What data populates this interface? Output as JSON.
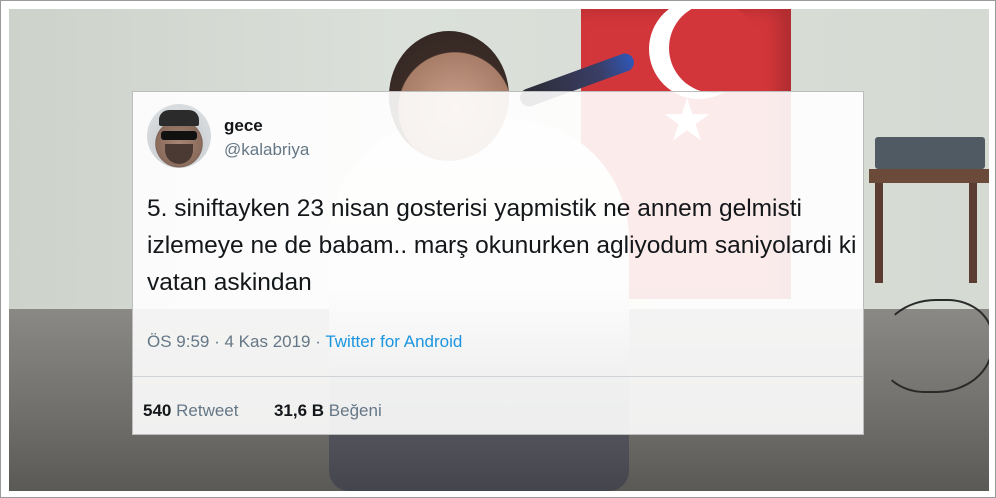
{
  "tweet": {
    "display_name": "gece",
    "handle": "@kalabriya",
    "text": "5. siniftayken 23 nisan gosterisi yapmistik ne annem gelmisti izlemeye ne de babam.. marş okunurken agliyodum saniyolardi ki vatan askindan",
    "time": "ÖS 9:59",
    "separator_dot": " · ",
    "date": "4 Kas 2019",
    "source": "Twitter for Android",
    "retweets_count": "540",
    "retweets_label": "Retweet",
    "likes_count": "31,6 B",
    "likes_label": "Beğeni"
  },
  "colors": {
    "link": "#1b95e0",
    "secondary_text": "#657786",
    "flag_red": "#d3363a"
  }
}
